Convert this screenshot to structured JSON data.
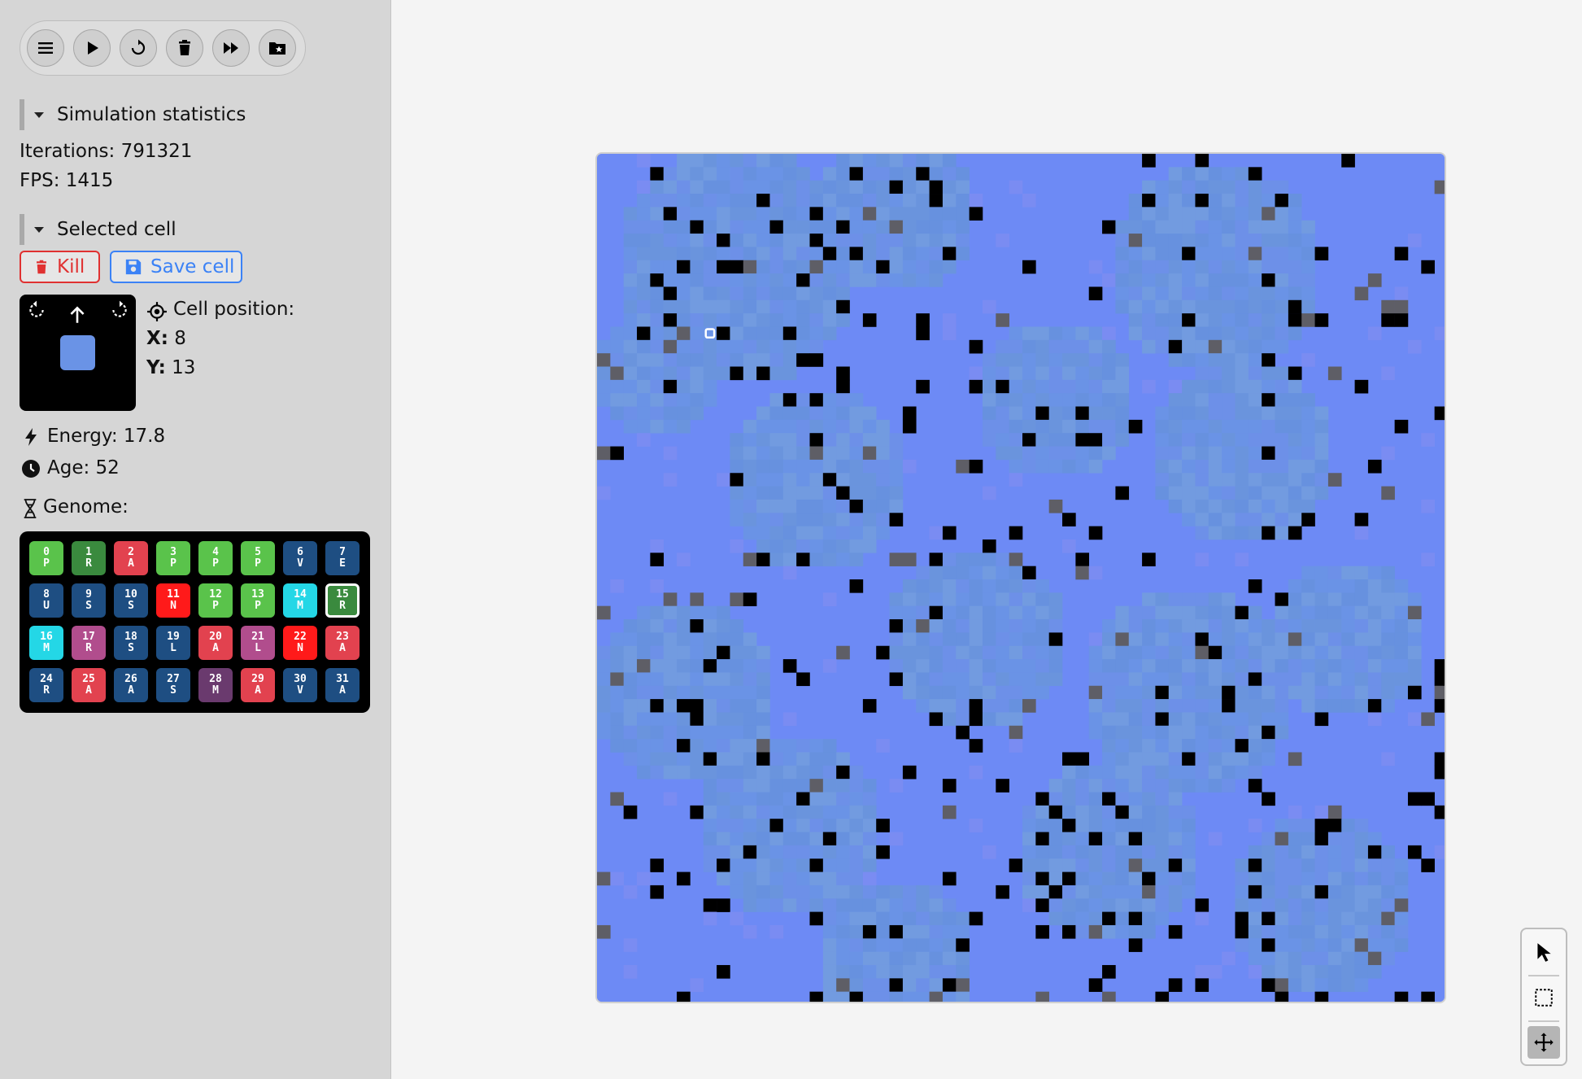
{
  "toolbar": {
    "buttons": [
      {
        "name": "menu-button",
        "icon": "menu-icon"
      },
      {
        "name": "play-button",
        "icon": "play-icon"
      },
      {
        "name": "reset-button",
        "icon": "reset-icon"
      },
      {
        "name": "clear-button",
        "icon": "trash-icon"
      },
      {
        "name": "fast-forward-button",
        "icon": "fast-forward-icon"
      },
      {
        "name": "saved-cells-button",
        "icon": "folder-star-icon"
      }
    ]
  },
  "stats": {
    "title": "Simulation statistics",
    "iterations": "Iterations: 791321",
    "fps": "FPS: 1415"
  },
  "selected": {
    "title": "Selected cell",
    "kill_label": "Kill",
    "save_label": "Save cell",
    "position_label": "Cell position:",
    "x_label": "X:",
    "x_value": "8",
    "y_label": "Y:",
    "y_value": "13",
    "energy": "Energy: 17.8",
    "age": "Age: 52",
    "genome_label": "Genome:",
    "cell_color": "#6a93e6"
  },
  "genome": [
    {
      "i": "0",
      "c": "P",
      "color": "#5ac34b"
    },
    {
      "i": "1",
      "c": "R",
      "color": "#3a8a3e"
    },
    {
      "i": "2",
      "c": "A",
      "color": "#e2424f"
    },
    {
      "i": "3",
      "c": "P",
      "color": "#5ac34b"
    },
    {
      "i": "4",
      "c": "P",
      "color": "#5ac34b"
    },
    {
      "i": "5",
      "c": "P",
      "color": "#5ac34b"
    },
    {
      "i": "6",
      "c": "V",
      "color": "#1e4e82"
    },
    {
      "i": "7",
      "c": "E",
      "color": "#1e4e82"
    },
    {
      "i": "8",
      "c": "U",
      "color": "#1e4e82"
    },
    {
      "i": "9",
      "c": "S",
      "color": "#1e4e82"
    },
    {
      "i": "10",
      "c": "S",
      "color": "#1e4e82"
    },
    {
      "i": "11",
      "c": "N",
      "color": "#ff1a1a"
    },
    {
      "i": "12",
      "c": "P",
      "color": "#5ac34b"
    },
    {
      "i": "13",
      "c": "P",
      "color": "#5ac34b"
    },
    {
      "i": "14",
      "c": "M",
      "color": "#24d7e6"
    },
    {
      "i": "15",
      "c": "R",
      "color": "#3a8a3e",
      "selected": true
    },
    {
      "i": "16",
      "c": "M",
      "color": "#24d7e6"
    },
    {
      "i": "17",
      "c": "R",
      "color": "#b14d8d"
    },
    {
      "i": "18",
      "c": "S",
      "color": "#1e4e82"
    },
    {
      "i": "19",
      "c": "L",
      "color": "#1e4e82"
    },
    {
      "i": "20",
      "c": "A",
      "color": "#e2424f"
    },
    {
      "i": "21",
      "c": "L",
      "color": "#b14d8d"
    },
    {
      "i": "22",
      "c": "N",
      "color": "#ff1a1a"
    },
    {
      "i": "23",
      "c": "A",
      "color": "#e2424f"
    },
    {
      "i": "24",
      "c": "R",
      "color": "#1e4e82"
    },
    {
      "i": "25",
      "c": "A",
      "color": "#e2424f"
    },
    {
      "i": "26",
      "c": "A",
      "color": "#1e4e82"
    },
    {
      "i": "27",
      "c": "S",
      "color": "#1e4e82"
    },
    {
      "i": "28",
      "c": "M",
      "color": "#6a3a6e"
    },
    {
      "i": "29",
      "c": "A",
      "color": "#e2424f"
    },
    {
      "i": "30",
      "c": "V",
      "color": "#1e4e82"
    },
    {
      "i": "31",
      "c": "A",
      "color": "#1e4e82"
    }
  ],
  "world": {
    "grid_size": 64,
    "selected_cell": {
      "x": 8,
      "y": 13
    },
    "colors": {
      "background": "#6d8af5",
      "colony": "#6a93e6",
      "wall": "#000000",
      "dead": "#5e5e66"
    }
  },
  "tools": [
    {
      "name": "pointer-tool",
      "icon": "cursor-icon"
    },
    {
      "name": "select-tool",
      "icon": "selection-icon"
    },
    {
      "name": "pan-tool",
      "icon": "move-icon",
      "active": true
    }
  ]
}
